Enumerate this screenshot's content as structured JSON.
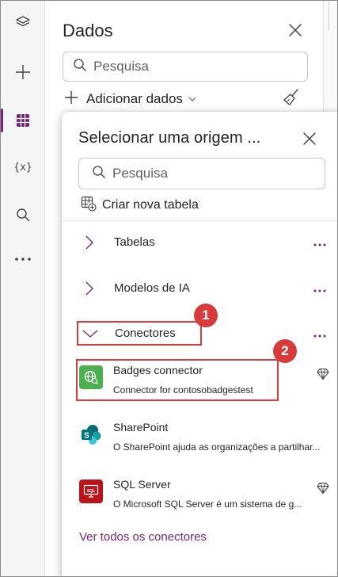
{
  "rail": {
    "items": [
      {
        "name": "tree-view",
        "icon": "layers-icon"
      },
      {
        "name": "insert",
        "icon": "plus-icon"
      },
      {
        "name": "data",
        "icon": "table-icon",
        "active": true
      },
      {
        "name": "variables",
        "icon": "variables-icon",
        "glyph": "{x}"
      },
      {
        "name": "search",
        "icon": "search-icon"
      },
      {
        "name": "more",
        "icon": "ellipsis-icon"
      }
    ],
    "active_color": "#742774"
  },
  "dados_pane": {
    "title": "Dados",
    "search_placeholder": "Pesquisa",
    "add_data_label": "Adicionar dados"
  },
  "popup": {
    "title": "Selecionar uma origem ...",
    "search_placeholder": "Pesquisa",
    "create_table_label": "Criar nova tabela",
    "groups": [
      {
        "label": "Tabelas",
        "expanded": false
      },
      {
        "label": "Modelos de IA",
        "expanded": false
      },
      {
        "label": "Conectores",
        "expanded": true
      }
    ],
    "connectors": [
      {
        "name": "Badges connector",
        "description": "Connector for contosobadgestest",
        "icon": "globe-connector-icon",
        "premium": true,
        "icon_color": "#4caf50"
      },
      {
        "name": "SharePoint",
        "description": "O SharePoint ajuda as organizações a partilhar...",
        "icon": "sharepoint-icon",
        "premium": false,
        "icon_color": "#036c70"
      },
      {
        "name": "SQL Server",
        "description": "O Microsoft SQL Server é um sistema de g...",
        "icon": "sql-server-icon",
        "premium": true,
        "icon_color": "#ba141a"
      }
    ],
    "see_all_label": "Ver todos os conectores"
  },
  "annotations": {
    "badge1": "1",
    "badge2": "2",
    "color": "#d83b3b"
  }
}
